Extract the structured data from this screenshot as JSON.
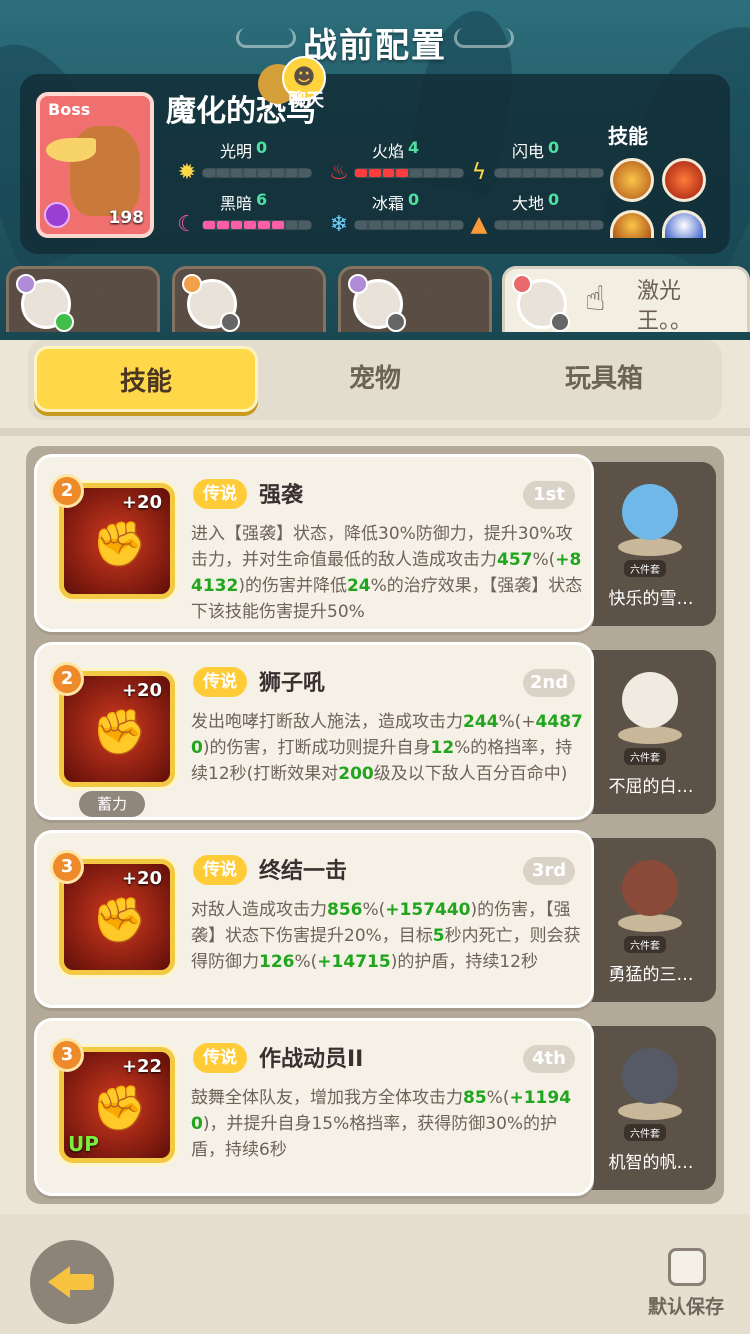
{
  "page": {
    "title": "战前配置"
  },
  "boss": {
    "tag": "Boss",
    "name": "魔化的恐鸟",
    "level": "198",
    "chat_label": "聊天"
  },
  "attributes": [
    {
      "name": "光明",
      "value": "0",
      "filled": 0,
      "color": "#ffd84a",
      "icon": "sun-icon"
    },
    {
      "name": "火焰",
      "value": "4",
      "filled": 4,
      "color": "#ff3d3d",
      "icon": "fire-icon"
    },
    {
      "name": "闪电",
      "value": "0",
      "filled": 0,
      "color": "#ffd84a",
      "icon": "lightning-icon"
    },
    {
      "name": "黑暗",
      "value": "6",
      "filled": 6,
      "color": "#ff5da6",
      "icon": "moon-icon"
    },
    {
      "name": "冰霜",
      "value": "0",
      "filled": 0,
      "color": "#6fd3ff",
      "icon": "snowflake-icon"
    },
    {
      "name": "大地",
      "value": "0",
      "filled": 0,
      "color": "#ff9a3a",
      "icon": "earth-icon"
    }
  ],
  "boss_skills": {
    "label": "技能"
  },
  "heroes": [
    {
      "name": "",
      "active": false
    },
    {
      "name": "",
      "active": false
    },
    {
      "name": "",
      "active": false
    },
    {
      "name": "激光王。。",
      "active": true
    }
  ],
  "tabs": {
    "skills": "技能",
    "pets": "宠物",
    "toybox": "玩具箱"
  },
  "skills": [
    {
      "level": "2",
      "bonus": "+20",
      "rarity": "传说",
      "name": "强袭",
      "order": "1st",
      "desc": [
        {
          "t": "进入【强袭】状态，降低30%防御力，提升30%攻击力，并对生命值最低的敌人造成攻击力"
        },
        {
          "t": "457",
          "g": true
        },
        {
          "t": "%(",
          "g": false
        },
        {
          "t": "+84132",
          "g": true
        },
        {
          "t": ")的伤害并降低"
        },
        {
          "t": "24",
          "g": true
        },
        {
          "t": "%的治疗效果，【强袭】状态下该技能伤害提升50%"
        }
      ],
      "pet": {
        "name": "快乐的雪…",
        "set": "六件套",
        "color": "#6fb8e8"
      }
    },
    {
      "level": "2",
      "bonus": "+20",
      "rarity": "传说",
      "name": "狮子吼",
      "order": "2nd",
      "charge": "蓄力",
      "desc": [
        {
          "t": "发出咆哮打断敌人施法，造成攻击力"
        },
        {
          "t": "244",
          "g": true
        },
        {
          "t": "%(+"
        },
        {
          "t": "44870",
          "g": true
        },
        {
          "t": ")的伤害，打断成功则提升自身"
        },
        {
          "t": "12",
          "g": true
        },
        {
          "t": "%的格挡率，持续12秒(打断效果对"
        },
        {
          "t": "200",
          "g": true
        },
        {
          "t": "级及以下敌人百分百命中)"
        }
      ],
      "pet": {
        "name": "不屈的白…",
        "set": "六件套",
        "color": "#f0ebe0"
      }
    },
    {
      "level": "3",
      "bonus": "+20",
      "rarity": "传说",
      "name": "终结一击",
      "order": "3rd",
      "desc": [
        {
          "t": "对敌人造成攻击力"
        },
        {
          "t": "856",
          "g": true
        },
        {
          "t": "%("
        },
        {
          "t": "+157440",
          "g": true
        },
        {
          "t": ")的伤害，【强袭】状态下伤害提升20%，目标"
        },
        {
          "t": "5",
          "g": true
        },
        {
          "t": "秒内死亡，则会获得防御力"
        },
        {
          "t": "126",
          "g": true
        },
        {
          "t": "%("
        },
        {
          "t": "+14715",
          "g": true
        },
        {
          "t": ")的护盾，持续12秒"
        }
      ],
      "pet": {
        "name": "勇猛的三…",
        "set": "六件套",
        "color": "#8a4a3a"
      }
    },
    {
      "level": "3",
      "bonus": "+22",
      "rarity": "传说",
      "name": "作战动员II",
      "order": "4th",
      "up": "UP",
      "desc": [
        {
          "t": "鼓舞全体队友，增加我方全体攻击力"
        },
        {
          "t": "85",
          "g": true
        },
        {
          "t": "%("
        },
        {
          "t": "+11940",
          "g": true
        },
        {
          "t": ")，并提升自身15%格挡率，获得防御30%的护盾，持续6秒"
        }
      ],
      "pet": {
        "name": "机智的帆…",
        "set": "六件套",
        "color": "#555a66"
      }
    }
  ],
  "footer": {
    "save_label": "默认保存"
  }
}
